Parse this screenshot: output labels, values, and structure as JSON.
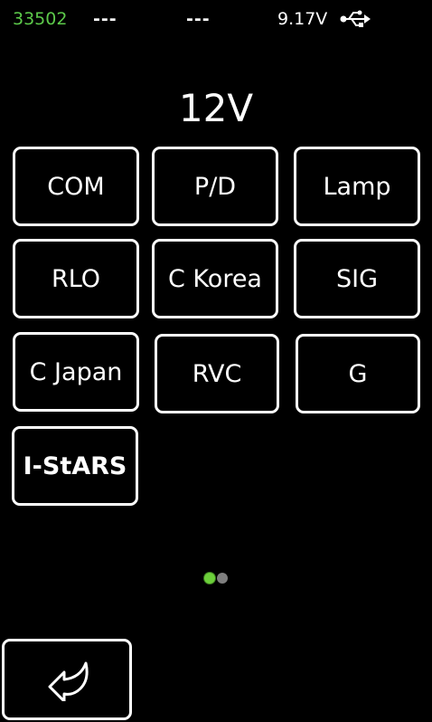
{
  "status_bar": {
    "counter": "33502",
    "field_a": "---",
    "field_b": "---",
    "voltage": "9.17V",
    "connection_icon": "usb-icon"
  },
  "title": "12V",
  "buttons": [
    {
      "label": "COM"
    },
    {
      "label": "P/D"
    },
    {
      "label": "Lamp"
    },
    {
      "label": "RLO"
    },
    {
      "label": "C Korea"
    },
    {
      "label": "SIG"
    },
    {
      "label": "C Japan"
    },
    {
      "label": "RVC"
    },
    {
      "label": "G"
    },
    {
      "label": "I-StARS"
    }
  ],
  "pager": {
    "current_page": 1,
    "total_pages": 2
  },
  "back_button": {
    "icon": "back-arrow-icon"
  },
  "colors": {
    "background": "#000000",
    "foreground": "#ffffff",
    "accent_green": "#5cc94a",
    "pager_inactive": "#7f7f7f"
  }
}
